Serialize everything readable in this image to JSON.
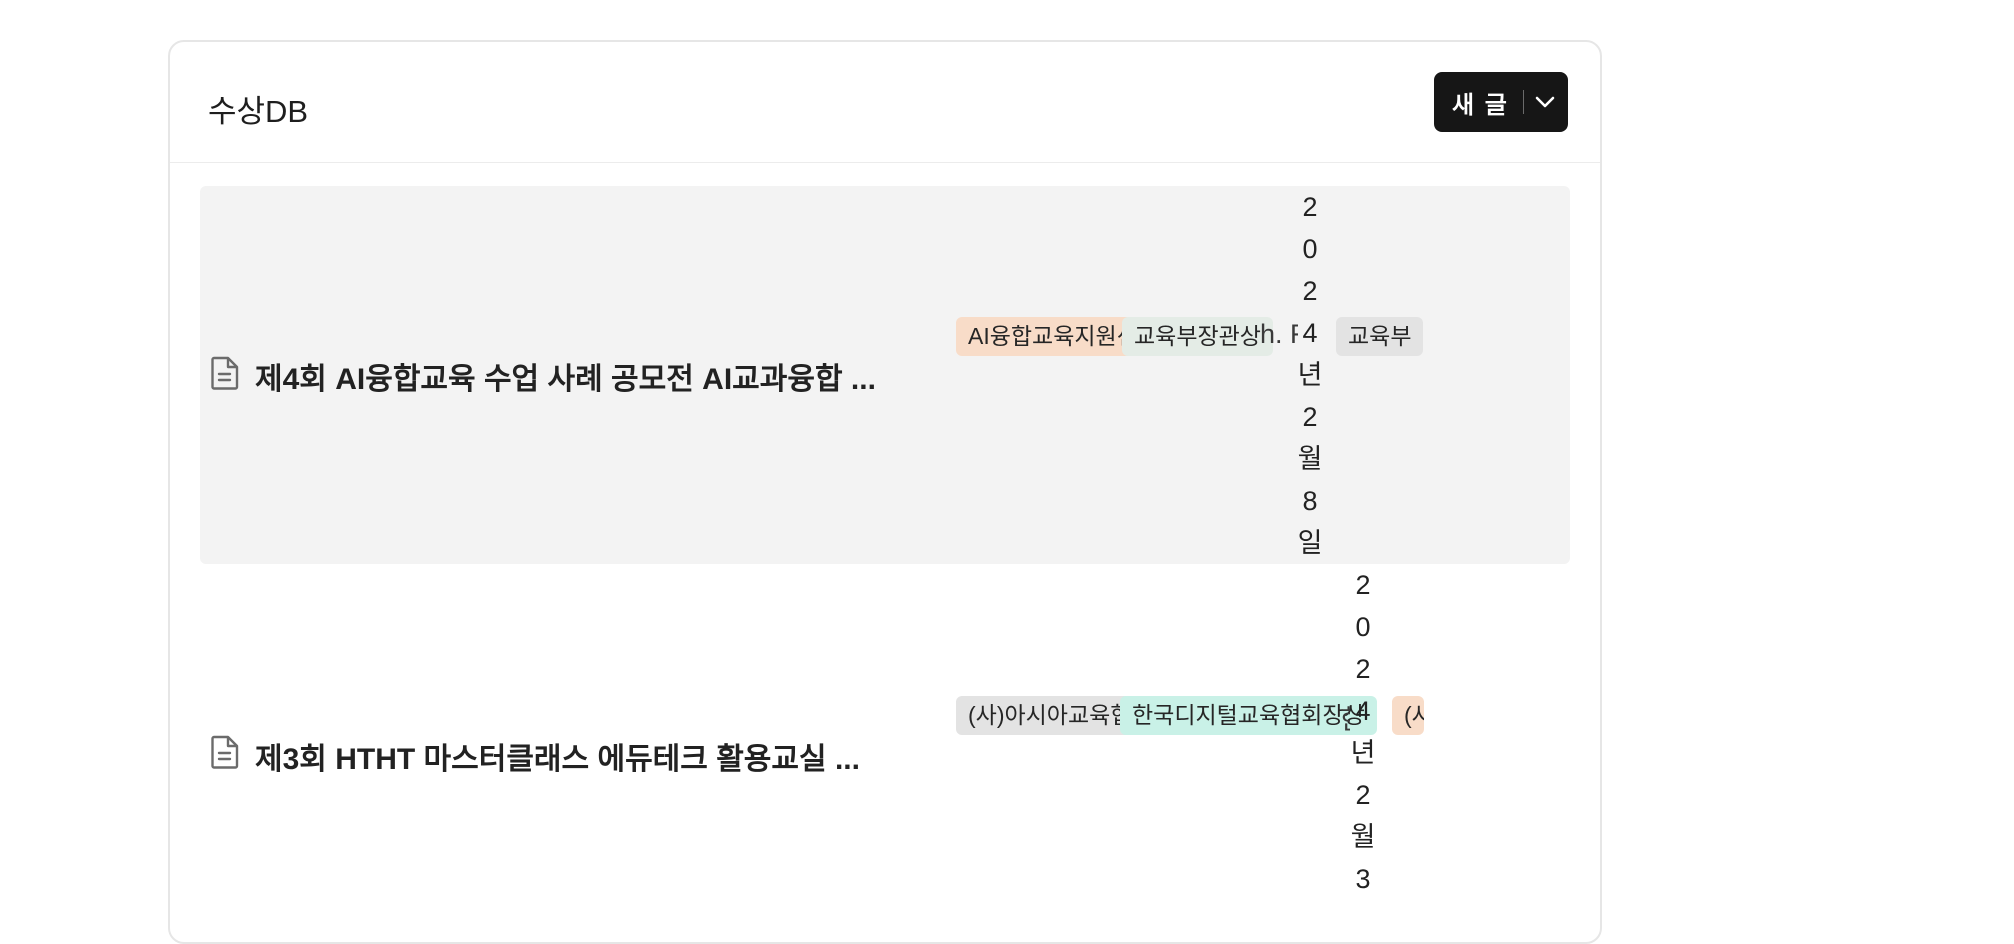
{
  "page": {
    "title": "수상DB",
    "new_button_label": "새 글"
  },
  "rows": [
    {
      "title": "제4회 AI융합교육 수업 사례 공모전 AI교과융합 ...",
      "tag1": "AI융합교육지원센터",
      "tag2": "교육부장관상",
      "clipped_text": "h. F",
      "date_chars": [
        "2",
        "0",
        "2",
        "4",
        "년",
        "2",
        "월",
        "8",
        "일"
      ],
      "tag3": "교육부"
    },
    {
      "title": "제3회 HTHT 마스터클래스 에듀테크 활용교실 ...",
      "tag1": "(사)아시아교육협회",
      "tag2": "한국디지털교육협회장상",
      "clipped_text": "한",
      "date_chars": [
        "2",
        "0",
        "2",
        "4",
        "년",
        "2",
        "월",
        "3"
      ],
      "tag3": "(사"
    }
  ],
  "colors": {
    "button_bg": "#161616",
    "row_highlight": "#f3f3f3",
    "tag_orange": "#f8dcc8",
    "tag_green": "#e4ece6",
    "tag_grey": "#e3e3e3",
    "tag_mint": "#c9f1e7"
  },
  "icons": {
    "doc": "document-icon",
    "dropdown": "chevron-down-icon"
  }
}
